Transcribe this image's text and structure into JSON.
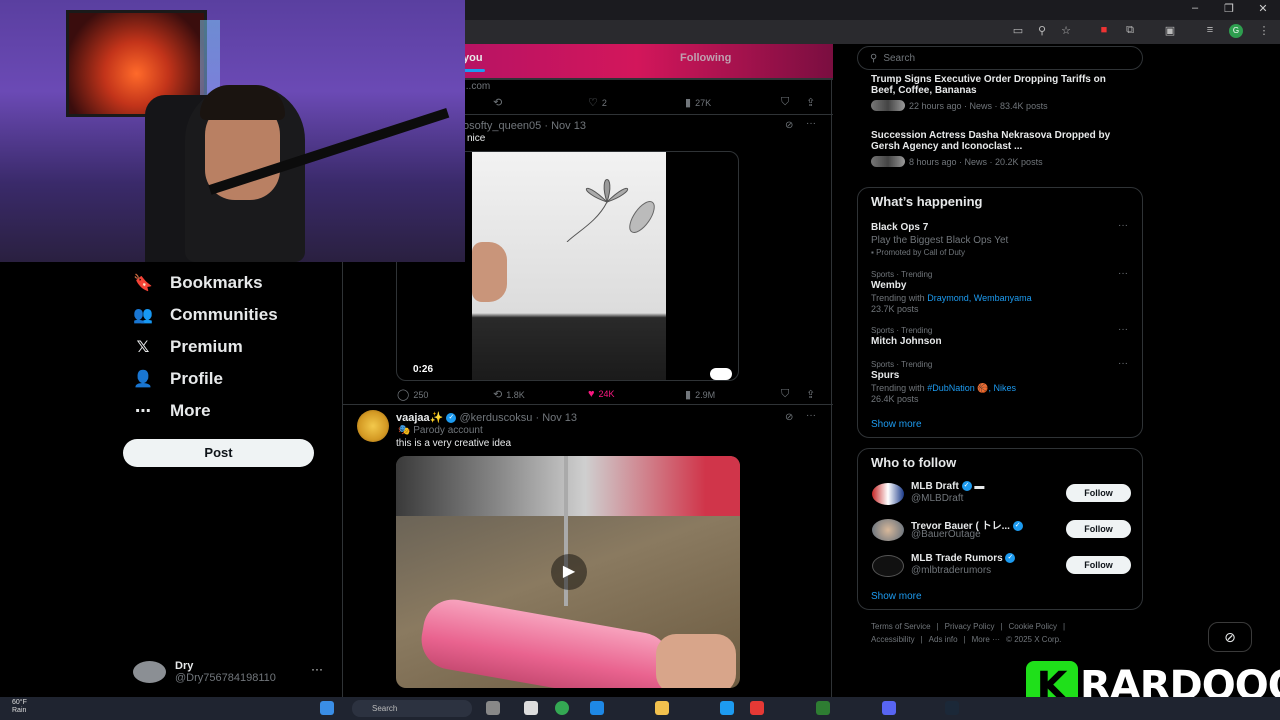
{
  "browser": {
    "window_controls": [
      "–",
      "❐",
      "✕"
    ]
  },
  "webcam": {},
  "nav": {
    "items": [
      {
        "label": "Bookmarks",
        "icon": "bookmark-icon",
        "glyph": "🔖"
      },
      {
        "label": "Communities",
        "icon": "communities-icon",
        "glyph": "👥"
      },
      {
        "label": "Premium",
        "icon": "x-logo-icon",
        "glyph": "𝕏"
      },
      {
        "label": "Profile",
        "icon": "profile-icon",
        "glyph": "👤"
      },
      {
        "label": "More",
        "icon": "more-circle-icon",
        "glyph": "⋯"
      }
    ],
    "post_label": "Post",
    "account": {
      "name": "Dry",
      "handle": "@Dry756784198110"
    }
  },
  "feed": {
    "tabs": [
      "you",
      "Following"
    ],
    "fragment": "...com",
    "tweet0_actions": {
      "likes": "2",
      "views": "27K"
    },
    "tweet1": {
      "handle": "osofty_queen05",
      "date": "Nov 13",
      "text": "nice",
      "video_time": "0:26",
      "actions": {
        "replies": "250",
        "reposts": "1.8K",
        "likes": "24K",
        "views": "2.9M"
      }
    },
    "tweet2": {
      "name": "vaajaa✨",
      "handle": "@kerduscoksu",
      "date": "Nov 13",
      "badge": "Parody account",
      "text": "this is a very creative idea"
    }
  },
  "sidebar": {
    "search_placeholder": "Search",
    "news": [
      {
        "title": "Trump Signs Executive Order Dropping Tariffs on Beef, Coffee, Bananas",
        "meta": "22 hours ago · News · 83.4K posts"
      },
      {
        "title": "Succession Actress Dasha Nekrasova Dropped by Gersh Agency and Iconoclast ...",
        "meta": "8 hours ago · News · 20.2K posts"
      }
    ],
    "happening": {
      "heading": "What’s happening",
      "promo": {
        "title": "Black Ops 7",
        "sub": "Play the Biggest Black Ops Yet",
        "promoted": "Promoted by Call of Duty"
      },
      "trends": [
        {
          "context": "Sports · Trending",
          "name": "Wemby",
          "with_label": "Trending with",
          "with_links": "Draymond, Wembanyama",
          "posts": "23.7K posts"
        },
        {
          "context": "Sports · Trending",
          "name": "Mitch Johnson"
        },
        {
          "context": "Sports · Trending",
          "name": "Spurs",
          "with_label": "Trending with",
          "with_links": "#DubNation 🏀, Nikes",
          "posts": "26.4K posts"
        }
      ],
      "show_more": "Show more"
    },
    "who_to_follow": {
      "heading": "Who to follow",
      "accounts": [
        {
          "name": "MLB Draft",
          "handle": "@MLBDraft",
          "button": "Follow"
        },
        {
          "name": "Trevor Bauer ( トレ...",
          "handle": "@BauerOutage",
          "button": "Follow"
        },
        {
          "name": "MLB Trade Rumors",
          "handle": "@mlbtraderumors",
          "button": "Follow"
        }
      ],
      "show_more": "Show more"
    },
    "footer": {
      "line1": [
        "Terms of Service",
        "|",
        "Privacy Policy",
        "|",
        "Cookie Policy",
        "|"
      ],
      "line2": [
        "Accessibility",
        "|",
        "Ads info",
        "|",
        "More ···",
        "© 2025 X Corp."
      ]
    }
  },
  "overlay_logo": {
    "text": "RARDOOO",
    "letter": "K"
  },
  "taskbar": {
    "weather_temp": "60°F",
    "weather_desc": "Rain",
    "search": "Search"
  }
}
